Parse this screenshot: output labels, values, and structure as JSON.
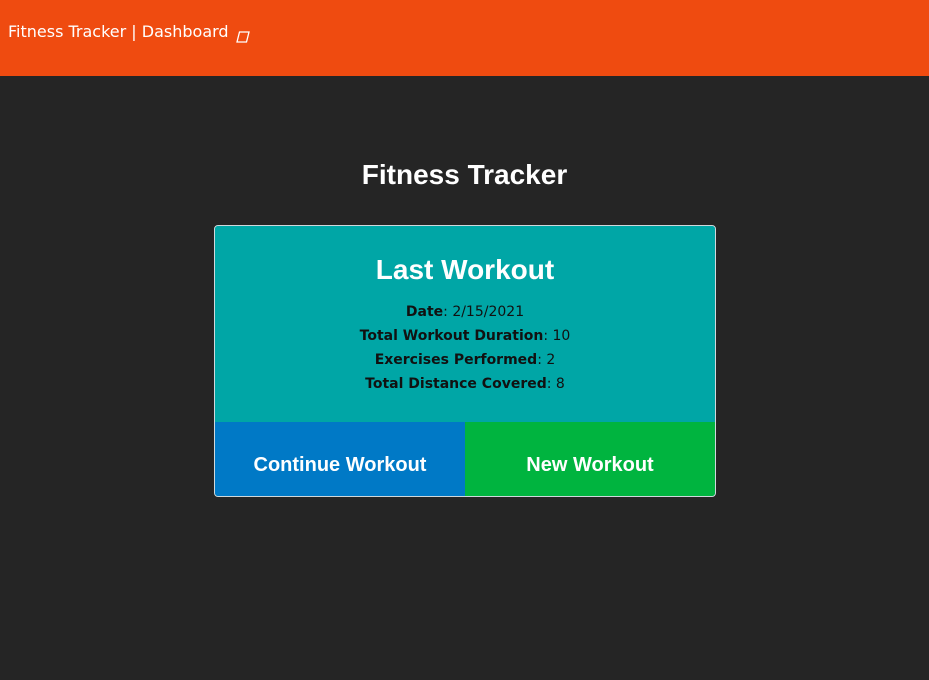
{
  "navbar": {
    "brand_label": "Fitness Tracker | Dashboard",
    "brand_icon": "dumbbell-icon",
    "background_color": "#ef4b10"
  },
  "page": {
    "title": "Fitness Tracker",
    "background_color": "#252525"
  },
  "last_workout": {
    "title": "Last Workout",
    "card_color": "#00a6a6",
    "stats": [
      {
        "label": "Date",
        "value": "2/15/2021"
      },
      {
        "label": "Total Workout Duration",
        "value": "10"
      },
      {
        "label": "Exercises Performed",
        "value": "2"
      },
      {
        "label": "Total Distance Covered",
        "value": "8"
      }
    ],
    "separator": ": "
  },
  "actions": {
    "continue_label": "Continue Workout",
    "continue_color": "#0079c6",
    "new_label": "New Workout",
    "new_color": "#00b43f"
  }
}
